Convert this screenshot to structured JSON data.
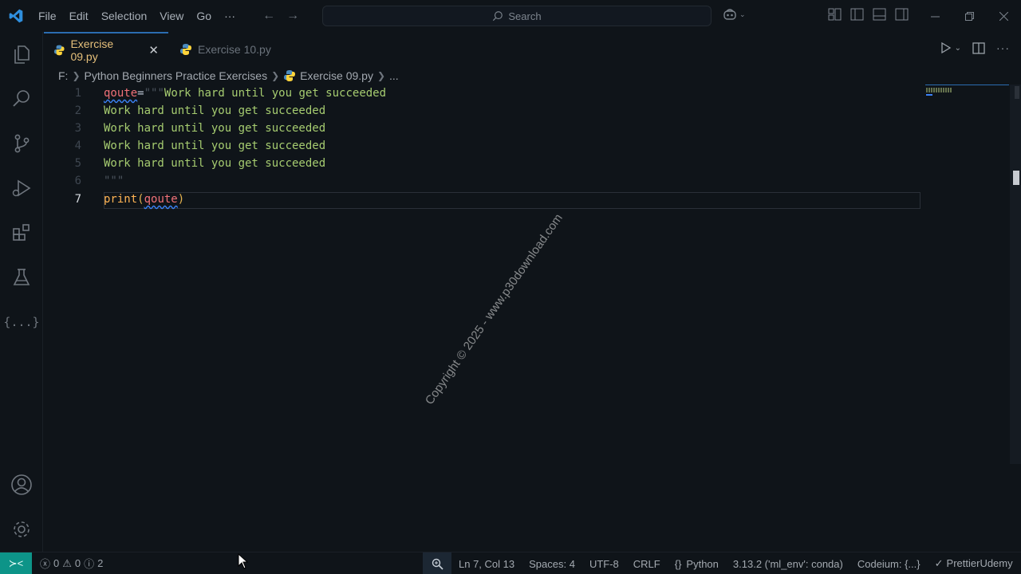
{
  "menu": {
    "items": [
      "File",
      "Edit",
      "Selection",
      "View",
      "Go",
      "···"
    ]
  },
  "search": {
    "label": "Search"
  },
  "tabs": [
    {
      "label": "Exercise 09.py",
      "active": true
    },
    {
      "label": "Exercise 10.py",
      "active": false
    }
  ],
  "breadcrumb": {
    "drive": "F:",
    "folder": "Python Beginners Practice Exercises",
    "file": "Exercise 09.py",
    "more": "..."
  },
  "code": {
    "lines": [
      {
        "number": "1",
        "var": "qoute",
        "op": "=",
        "q": "\"\"\"",
        "text": "Work hard until you get succeeded"
      },
      {
        "number": "2",
        "text": "Work hard until you get succeeded"
      },
      {
        "number": "3",
        "text": "Work hard until you get succeeded"
      },
      {
        "number": "4",
        "text": "Work hard until you get succeeded"
      },
      {
        "number": "5",
        "text": "Work hard until you get succeeded"
      },
      {
        "number": "6",
        "text": "\"\"\""
      },
      {
        "number": "7",
        "fn": "print",
        "open": "(",
        "arg": "qoute",
        "close": ")"
      }
    ]
  },
  "watermark": "Copyright © 2025 - www.p30download.com",
  "status": {
    "errors": "0",
    "warnings": "0",
    "info": "2",
    "position": "Ln 7, Col 13",
    "spaces": "Spaces: 4",
    "encoding": "UTF-8",
    "eol": "CRLF",
    "language": "Python",
    "interpreter": "3.13.2 ('ml_env': conda)",
    "codeium": "Codeium: {...}",
    "prettier": "Prettier",
    "udemy": "Udemy"
  },
  "colors": {
    "accent": "#2b6cb0",
    "remote": "#0d9488",
    "string": "#a6cc70",
    "variable": "#f07178",
    "function": "#ffb454"
  }
}
